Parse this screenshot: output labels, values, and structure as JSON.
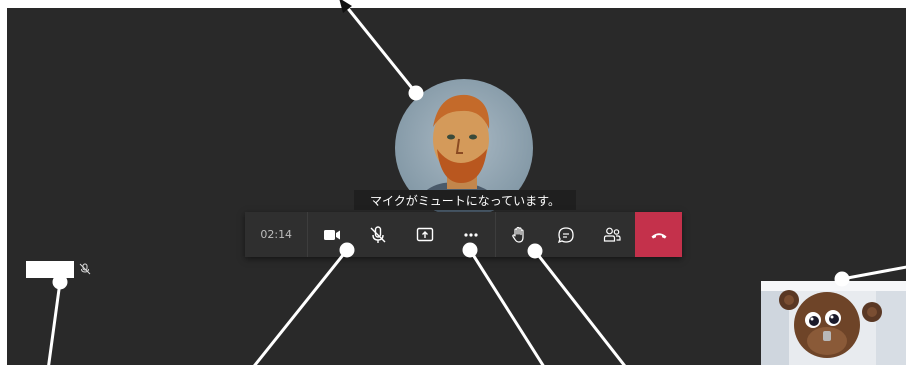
{
  "toast": {
    "text": "マイクがミュートになっています。"
  },
  "toolbar": {
    "timer": "02:14",
    "buttons": [
      {
        "icon": "video-camera-icon"
      },
      {
        "icon": "mic-muted-icon"
      },
      {
        "icon": "share-screen-icon"
      },
      {
        "icon": "more-options-icon"
      },
      {
        "icon": "raise-hand-icon"
      },
      {
        "icon": "chat-icon"
      },
      {
        "icon": "participants-icon"
      },
      {
        "icon": "hang-up-icon"
      }
    ]
  },
  "colors": {
    "stage_bg": "#292929",
    "toolbar_bg": "#2f2f2f",
    "hangup_red": "#c4314b",
    "annotation": "#ffffff"
  }
}
